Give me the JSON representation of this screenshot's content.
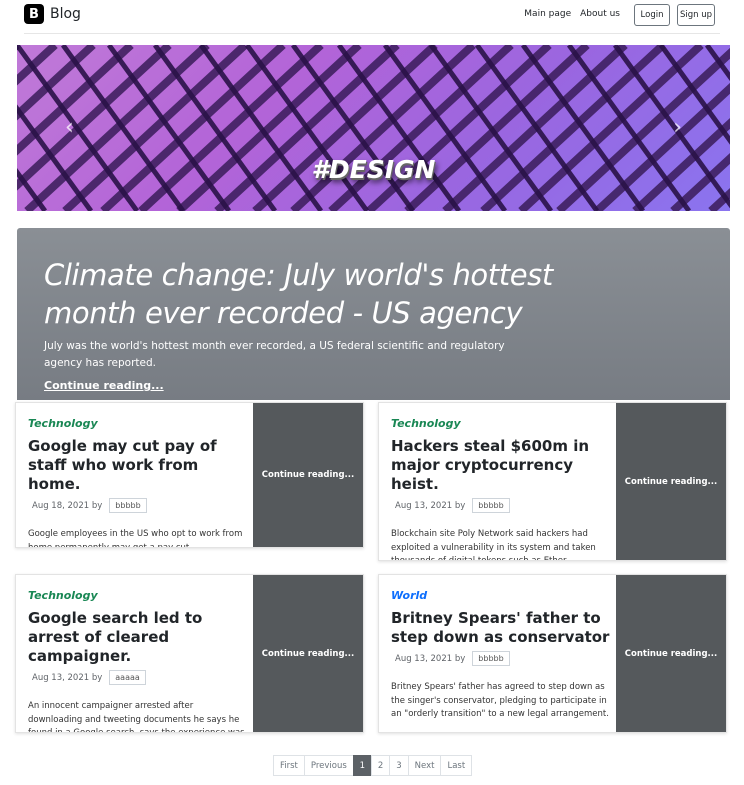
{
  "navbar": {
    "logo": "B",
    "brand": "Blog",
    "links": [
      "Main page",
      "About us"
    ],
    "login_label": "Login",
    "signup_label": "Sign up"
  },
  "carousel": {
    "caption": "#DESIGN",
    "prev_icon": "chevron-left-icon",
    "next_icon": "chevron-right-icon",
    "slides": 3,
    "active_slide": 1
  },
  "hero": {
    "title": "Climate change: July world's hottest month ever recorded - US agency",
    "lead": "July was the world's hottest month ever recorded, a US federal scientific and regulatory agency has reported.",
    "link": "Continue reading..."
  },
  "posts": [
    {
      "category": "Technology",
      "title": "Google may cut pay of staff who work from home.",
      "date": "Aug 18, 2021 by",
      "author": "bbbbb",
      "excerpt": "Google employees in the US who opt to work from home permanently may get a pay cut.",
      "cta": "Continue reading..."
    },
    {
      "category": "Technology",
      "title": "Hackers steal $600m in major cryptocurrency heist.",
      "date": "Aug 13, 2021 by",
      "author": "bbbbb",
      "excerpt": "Blockchain site Poly Network said hackers had exploited a vulnerability in its system and taken thousands of digital tokens such as Ether.",
      "cta": "Continue reading..."
    },
    {
      "category": "Technology",
      "title": "Google search led to arrest of cleared campaigner.",
      "date": "Aug 13, 2021 by",
      "author": "aaaaa",
      "excerpt": "An innocent campaigner arrested after downloading and tweeting documents he says he found in a Google search, says the experience was \"horrendous\".",
      "cta": "Continue reading..."
    },
    {
      "category": "World",
      "title": "Britney Spears' father to step down as conservator",
      "date": "Aug 13, 2021 by",
      "author": "bbbbb",
      "excerpt": "Britney Spears' father has agreed to step down as the singer's conservator, pledging to participate in an \"orderly transition\" to a new legal arrangement.",
      "cta": "Continue reading..."
    }
  ],
  "pagination": [
    "First",
    "Previous",
    "1",
    "2",
    "3",
    "Next",
    "Last"
  ],
  "pagination_active": "1",
  "colors": {
    "technology": "#198754",
    "world": "#0d6efd",
    "hero_bg": "#80858b",
    "card_cta_bg": "#55595c",
    "page_active_bg": "#5c6166"
  }
}
